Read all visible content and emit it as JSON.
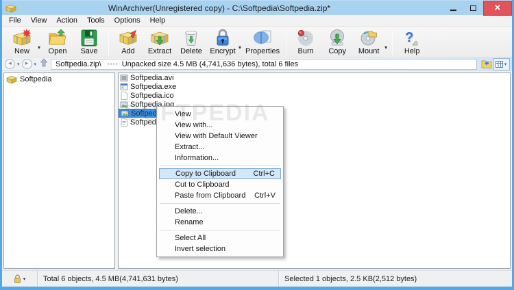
{
  "window": {
    "title": "WinArchiver(Unregistered copy) - C:\\Softpedia\\Softpedia.zip*"
  },
  "icons": {
    "close": "×",
    "dropdown_caret": "▾",
    "back_arrow": "◂",
    "forward_arrow": "▸",
    "help_glyph": "?"
  },
  "menubar": {
    "items": [
      "File",
      "View",
      "Action",
      "Tools",
      "Options",
      "Help"
    ]
  },
  "toolbar": {
    "buttons": [
      {
        "label": "New",
        "icon": "new-archive-icon",
        "has_dropdown": true
      },
      {
        "label": "Open",
        "icon": "open-archive-icon"
      },
      {
        "label": "Save",
        "icon": "save-icon"
      },
      {
        "label": "Add",
        "icon": "add-files-icon"
      },
      {
        "label": "Extract",
        "icon": "extract-icon"
      },
      {
        "label": "Delete",
        "icon": "delete-icon"
      },
      {
        "label": "Encrypt",
        "icon": "encrypt-icon",
        "has_dropdown": true
      },
      {
        "label": "Properties",
        "icon": "properties-icon"
      },
      {
        "label": "Burn",
        "icon": "burn-icon"
      },
      {
        "label": "Copy",
        "icon": "copy-disc-icon"
      },
      {
        "label": "Mount",
        "icon": "mount-icon",
        "has_dropdown": true
      },
      {
        "label": "Help",
        "icon": "help-icon"
      }
    ]
  },
  "addressbar": {
    "path": "Softpedia.zip\\",
    "info": "Unpacked size 4.5 MB (4,741,636 bytes), total 6 files"
  },
  "tree": {
    "root": "Softpedia"
  },
  "files": [
    {
      "name": "Softpedia.avi",
      "type": "video",
      "selected": false
    },
    {
      "name": "Softpedia.exe",
      "type": "executable",
      "selected": false
    },
    {
      "name": "Softpedia.ico",
      "type": "icon",
      "selected": false
    },
    {
      "name": "Softpedia.jpg",
      "type": "image",
      "selected": false
    },
    {
      "name": "Softpedia.png",
      "type": "image",
      "selected": true
    },
    {
      "name": "Softpedia.txt",
      "type": "text",
      "selected": false
    }
  ],
  "context_menu": {
    "groups": [
      {
        "items": [
          {
            "label": "View",
            "shortcut": ""
          },
          {
            "label": "View with...",
            "shortcut": ""
          },
          {
            "label": "View with Default Viewer",
            "shortcut": ""
          },
          {
            "label": "Extract...",
            "shortcut": ""
          },
          {
            "label": "Information...",
            "shortcut": ""
          }
        ]
      },
      {
        "items": [
          {
            "label": "Copy to Clipboard",
            "shortcut": "Ctrl+C",
            "highlighted": true
          },
          {
            "label": "Cut to Clipboard",
            "shortcut": ""
          },
          {
            "label": "Paste from Clipboard",
            "shortcut": "Ctrl+V"
          }
        ]
      },
      {
        "items": [
          {
            "label": "Delete...",
            "shortcut": ""
          },
          {
            "label": "Rename",
            "shortcut": ""
          }
        ]
      },
      {
        "items": [
          {
            "label": "Select All",
            "shortcut": ""
          },
          {
            "label": "Invert selection",
            "shortcut": ""
          }
        ]
      }
    ]
  },
  "statusbar": {
    "total": "Total 6 objects, 4.5 MB(4,741,631 bytes)",
    "selected": "Selected 1 objects, 2.5 KB(2,512 bytes)"
  },
  "watermark": "SOFTPEDIA",
  "colors": {
    "titlebar": "#a9d2f1",
    "window_border": "#56a7e2",
    "close_button": "#e0545c",
    "file_selection": "#3e90e0",
    "menu_highlight": "#d3e7fa",
    "menu_highlight_border": "#7da9d8"
  }
}
